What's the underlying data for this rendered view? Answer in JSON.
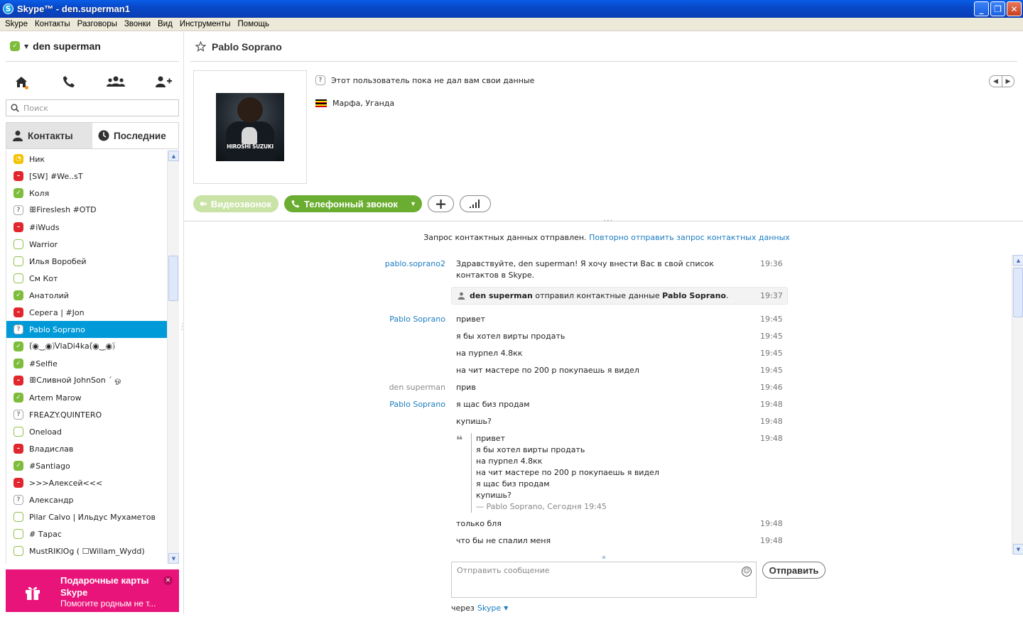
{
  "window": {
    "title": "Skype™ - den.superman1",
    "buttons": [
      "_",
      "❐",
      "✕"
    ]
  },
  "menu": [
    "Skype",
    "Контакты",
    "Разговоры",
    "Звонки",
    "Вид",
    "Инструменты",
    "Помощь"
  ],
  "profile": {
    "name": "den superman",
    "status": "online"
  },
  "search": {
    "placeholder": "Поиск"
  },
  "tabs": [
    {
      "label": "Контакты",
      "icon": "person-icon"
    },
    {
      "label": "Последние",
      "icon": "clock-icon"
    }
  ],
  "contacts": [
    {
      "name": "Ник",
      "status": "away"
    },
    {
      "name": "[SW] #We..sT",
      "status": "busy"
    },
    {
      "name": "Коля",
      "status": "online"
    },
    {
      "name": "ꕥFireslesh #OTD",
      "status": "unknown"
    },
    {
      "name": "#iWuds",
      "status": "busy"
    },
    {
      "name": "Warrior",
      "status": "offline"
    },
    {
      "name": "Илья Воробей",
      "status": "offline"
    },
    {
      "name": "См Кот",
      "status": "offline"
    },
    {
      "name": "Анатолий",
      "status": "online"
    },
    {
      "name": "Серега | #Jon",
      "status": "busy"
    },
    {
      "name": "Pablo Soprano",
      "status": "unknown",
      "selected": true
    },
    {
      "name": "ۜ(◉‿◉)ۜVlaDi4kaۜ(◉‿◉)ۜ",
      "status": "online"
    },
    {
      "name": "#Selfie",
      "status": "online"
    },
    {
      "name": "ꕥСливной JohnSon ´ ஓ",
      "status": "busy"
    },
    {
      "name": "Artem Marow",
      "status": "online"
    },
    {
      "name": "FREAZY.QUINTERO",
      "status": "unknown"
    },
    {
      "name": "Oneload",
      "status": "offline"
    },
    {
      "name": "Владислав",
      "status": "busy"
    },
    {
      "name": "#Santiago",
      "status": "online"
    },
    {
      "name": ">>>Алексей<<<",
      "status": "busy"
    },
    {
      "name": "Александр",
      "status": "unknown"
    },
    {
      "name": "Pilar Calvo | Ильдус Мухаметов",
      "status": "offline"
    },
    {
      "name": "# Тарас",
      "status": "offline"
    },
    {
      "name": "MustRIKlOg ( ☐Willam_Wydd)",
      "status": "offline"
    }
  ],
  "contact_scroll_fraction": 0.27,
  "promo": {
    "title": "Подарочные карты Skype",
    "subtitle": "Помогите родным не т..."
  },
  "conversation": {
    "name": "Pablo Soprano",
    "avatar_caption": "HIROSHI SUZUKI",
    "info_unknown": "Этот пользователь пока не дал вам свои данные",
    "location": "Марфа, Уганда",
    "video_label": "Видеозвонок",
    "phone_label": "Телефонный звонок",
    "request_text": "Запрос контактных данных отправлен.",
    "request_link": "Повторно отправить запрос контактных данных"
  },
  "messages": [
    {
      "sender": "pablo.soprano2",
      "me": false,
      "text": "Здравствуйте, den superman! Я хочу внести Вас в свой список контактов в Skype.",
      "time": "19:36"
    },
    {
      "system": true,
      "from": "den superman",
      "middle": "отправил контактные данные",
      "to": "Pablo Soprano",
      "end": ".",
      "time": "19:37"
    },
    {
      "sender": "Pablo Soprano",
      "me": false,
      "text": "привет",
      "time": "19:45"
    },
    {
      "sender": "",
      "text": "я бы хотел вирты продать",
      "time": "19:45"
    },
    {
      "sender": "",
      "text": "на пурпел 4.8кк",
      "time": "19:45"
    },
    {
      "sender": "",
      "text": "на чит мастере по 200 р покупаешь я видел",
      "time": "19:45"
    },
    {
      "sender": "den superman",
      "me": true,
      "text": "прив",
      "time": "19:46"
    },
    {
      "sender": "Pablo Soprano",
      "me": false,
      "text": "я щас биз продам",
      "time": "19:48"
    },
    {
      "sender": "",
      "text": "купишь?",
      "time": "19:48"
    },
    {
      "quote": true,
      "time": "19:48"
    },
    {
      "sender": "",
      "text": "только бля",
      "time": "19:48"
    },
    {
      "sender": "",
      "text": "что бы не спалил меня",
      "time": "19:48"
    }
  ],
  "quote": {
    "lines": [
      "привет",
      "я бы хотел вирты продать",
      "на пурпел 4.8кк",
      "на чит мастере по 200 р покупаешь я видел",
      "я щас биз продам",
      "купишь?"
    ],
    "footer": "— Pablo Soprano, Сегодня 19:45"
  },
  "compose": {
    "placeholder": "Отправить сообщение",
    "send_label": "Отправить",
    "via_label": "через",
    "via_service": "Skype"
  },
  "colors": {
    "accent": "#009ad8",
    "link": "#1a7cc0",
    "call_green": "#6aad31",
    "promo": "#e9147a"
  }
}
